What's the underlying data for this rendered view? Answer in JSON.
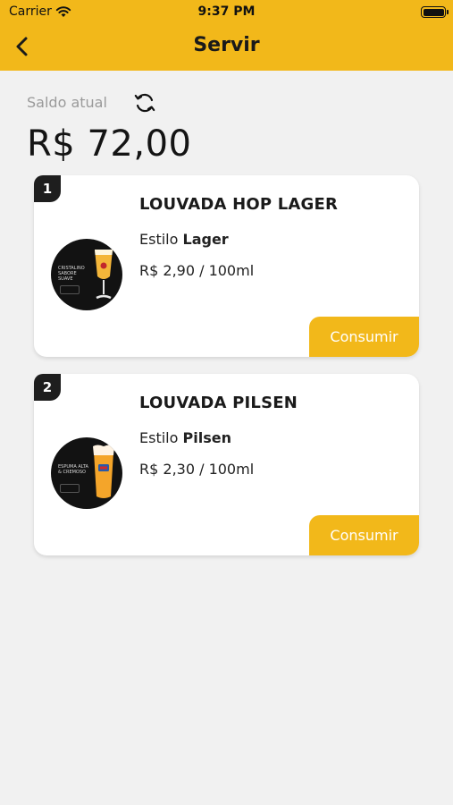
{
  "status_bar": {
    "carrier": "Carrier",
    "time": "9:37 PM"
  },
  "header": {
    "title": "Servir",
    "back_icon": "chevron-left-icon"
  },
  "balance": {
    "label": "Saldo atual",
    "value": "R$ 72,00",
    "refresh_icon": "refresh-icon"
  },
  "beers": [
    {
      "position": "1",
      "name": "LOUVADA HOP LAGER",
      "style_prefix": "Estilo",
      "style": "Lager",
      "price": "R$ 2,90 / 100ml",
      "button_label": "Consumir",
      "image_tag": "CRISTALINO SABORE SUAVE",
      "image_icon": "beer-glass-icon"
    },
    {
      "position": "2",
      "name": "LOUVADA PILSEN",
      "style_prefix": "Estilo",
      "style": "Pilsen",
      "price": "R$ 2,30 / 100ml",
      "button_label": "Consumir",
      "image_tag": "ESPUMA ALTA & CREMOSO",
      "image_icon": "beer-glass-icon"
    }
  ],
  "colors": {
    "accent": "#f2b81a",
    "background": "#f1f1f1",
    "card": "#ffffff",
    "badge": "#1e1e1e"
  }
}
